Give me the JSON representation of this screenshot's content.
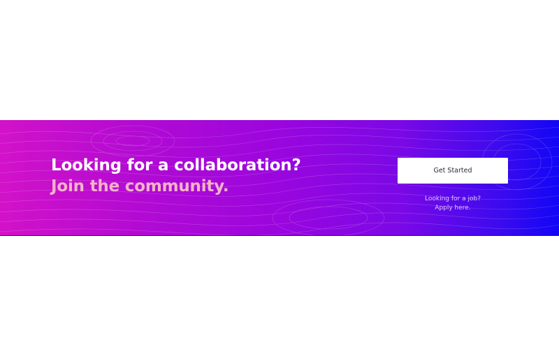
{
  "banner": {
    "headline_line1": "Looking for a collaboration?",
    "headline_line2": "Join the community.",
    "cta_label": "Get Started",
    "job_link_line1": "Looking for a job?",
    "job_link_line2": "Apply here."
  },
  "colors": {
    "gradient_start": "#d212c8",
    "gradient_mid": "#9a06de",
    "gradient_end": "#1106f6",
    "accent_text": "#f5b3c9",
    "button_bg": "#ffffff"
  }
}
